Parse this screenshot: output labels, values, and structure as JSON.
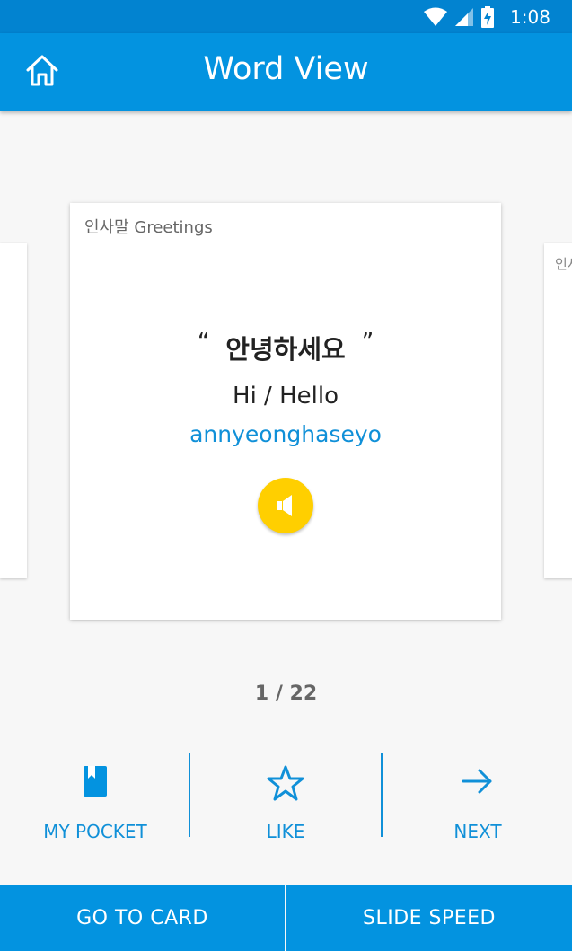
{
  "status": {
    "time": "1:08"
  },
  "app_bar": {
    "title": "Word View",
    "home_icon": "home-icon"
  },
  "card": {
    "category": "인사말 Greetings",
    "quote_open": "“",
    "word": "안녕하세요",
    "quote_close": "”",
    "meaning": "Hi / Hello",
    "romanization": "annyeonghaseyo",
    "speaker_icon": "speaker-icon"
  },
  "next_card_peek": {
    "category": "인사말"
  },
  "pagination": {
    "text": "1  /  22"
  },
  "actions": [
    {
      "label": "MY POCKET",
      "icon": "bookmark-icon"
    },
    {
      "label": "LIKE",
      "icon": "star-icon"
    },
    {
      "label": "NEXT",
      "icon": "arrow-right-icon"
    }
  ],
  "bottom_bar": {
    "go_to_card": "GO TO CARD",
    "slide_speed": "SLIDE SPEED"
  },
  "colors": {
    "primary": "#0393e0",
    "status_bar": "#0283d0",
    "accent_text": "#1090d8",
    "speaker": "#ffcf00"
  }
}
